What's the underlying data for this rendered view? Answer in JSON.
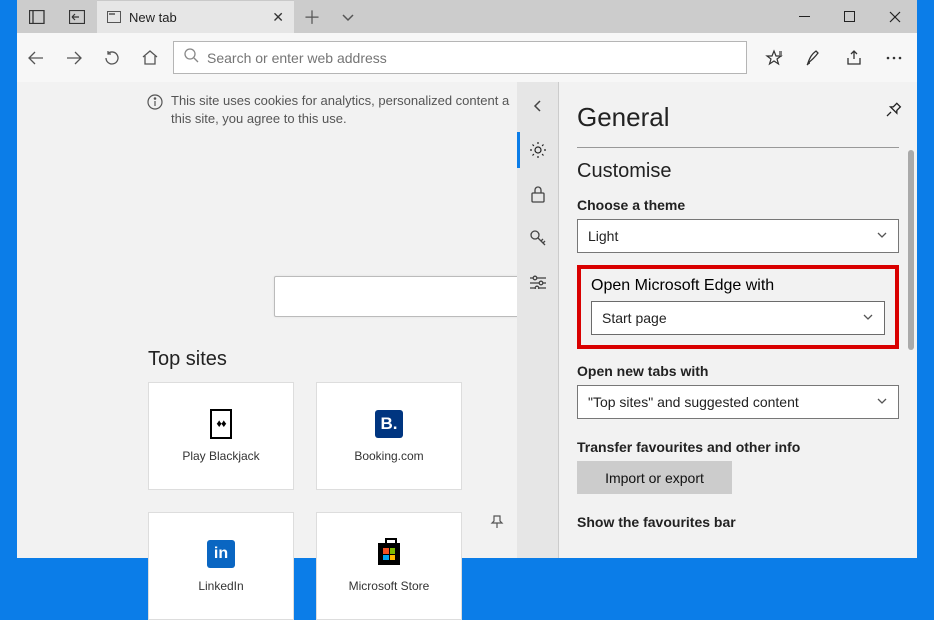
{
  "tab": {
    "title": "New tab"
  },
  "addr": {
    "placeholder": "Search or enter web address"
  },
  "cookie": {
    "line1": "This site uses cookies for analytics, personalized content a",
    "line2": "this site, you agree to this use."
  },
  "topSitesLabel": "Top sites",
  "tiles": [
    {
      "label": "Play Blackjack"
    },
    {
      "label": "Booking.com"
    },
    {
      "label": ""
    },
    {
      "label": "LinkedIn"
    },
    {
      "label": "Microsoft Store"
    }
  ],
  "settings": {
    "heading": "General",
    "customise": "Customise",
    "theme": {
      "label": "Choose a theme",
      "value": "Light"
    },
    "openWith": {
      "label": "Open Microsoft Edge with",
      "value": "Start page"
    },
    "newTabs": {
      "label": "Open new tabs with",
      "value": "\"Top sites\" and suggested content"
    },
    "transfer": {
      "label": "Transfer favourites and other info",
      "button": "Import or export"
    },
    "favBar": "Show the favourites bar"
  }
}
